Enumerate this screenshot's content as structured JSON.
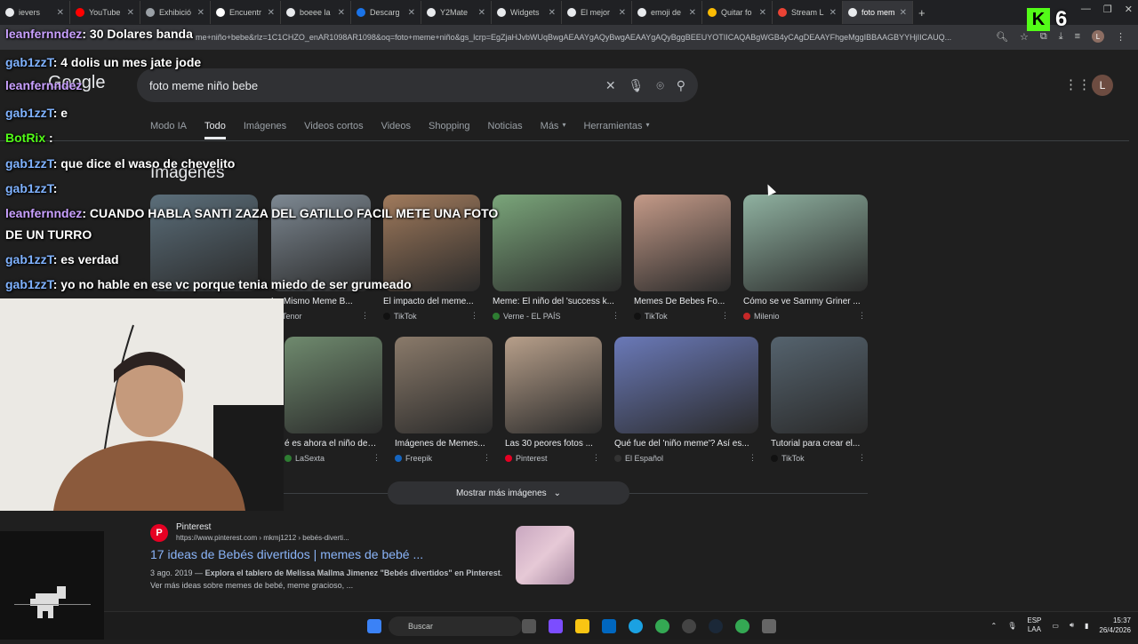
{
  "browser": {
    "tabs": [
      {
        "label": "ievers",
        "color": "#e8eaed"
      },
      {
        "label": "YouTube",
        "color": "#ff0000"
      },
      {
        "label": "Exhibició",
        "color": "#9aa0a6"
      },
      {
        "label": "Encuentr",
        "color": "#ffffff"
      },
      {
        "label": "boeee la",
        "color": "#e8eaed"
      },
      {
        "label": "Descarg",
        "color": "#1a73e8"
      },
      {
        "label": "Y2Mate",
        "color": "#e8eaed"
      },
      {
        "label": "Widgets",
        "color": "#e8eaed"
      },
      {
        "label": "El mejor",
        "color": "#e8eaed"
      },
      {
        "label": "emoji de",
        "color": "#e8eaed"
      },
      {
        "label": "Quitar fo",
        "color": "#fbbc04"
      },
      {
        "label": "Stream L",
        "color": "#ea4335"
      },
      {
        "label": "foto mem",
        "color": "#e8eaed",
        "active": true
      }
    ],
    "url": "me+niño+bebe&rlz=1C1CHZO_enAR1098AR1098&oq=foto+meme+niño&gs_lcrp=EgZjaHJvbWUqBwgAEAAYgAQyBwgAEAAYgAQyBggBEEUYOTIICAQABgWGB4yCAgDEAAYFhgeMggIBBAAGBYYHjIICAUQ...",
    "profile_initial": "L"
  },
  "google": {
    "logo": "Google",
    "query": "foto meme niño bebe",
    "avatar_initial": "L",
    "nav": [
      "Modo IA",
      "Todo",
      "Imágenes",
      "Videos cortos",
      "Videos",
      "Shopping",
      "Noticias",
      "Más",
      "Herramientas"
    ],
    "images_heading": "Imágenes",
    "images_row1": [
      {
        "caption": "",
        "source": ""
      },
      {
        "caption": "Lo Mismo Meme B...",
        "source": "Tenor"
      },
      {
        "caption": "El impacto del meme...",
        "source": "TikTok"
      },
      {
        "caption": "Meme: El niño del 'success k...",
        "source": "Verne - EL PAÍS"
      },
      {
        "caption": "Memes De Bebes Fo...",
        "source": "TikTok"
      },
      {
        "caption": "Cómo se ve Sammy Griner ...",
        "source": "Milenio"
      }
    ],
    "images_row2": [
      {
        "caption": "é es ahora el niño del ...",
        "source": "LaSexta"
      },
      {
        "caption": "Imágenes de Memes...",
        "source": "Freepik"
      },
      {
        "caption": "Las 30 peores fotos ...",
        "source": "Pinterest"
      },
      {
        "caption": "Qué fue del 'niño meme'? Así es...",
        "source": "El Español"
      },
      {
        "caption": "Tutorial para crear el...",
        "source": "TikTok"
      }
    ],
    "more_images": "Mostrar más imágenes",
    "result": {
      "site": "Pinterest",
      "cite": "https://www.pinterest.com › mkmj1212 › bebés-diverti...",
      "title": "17 ideas de Bebés divertidos | memes de bebé ...",
      "date": "3 ago. 2019",
      "snippet_bold": "Explora el tablero de Melissa Mallma Jimenez \"Bebés divertidos\" en Pinterest",
      "snippet_rest": ". Ver más ideas sobre memes de bebé, meme gracioso, ..."
    }
  },
  "stream": {
    "chat": [
      {
        "user": "leanfernndez",
        "text": ": 30 Dolares banda",
        "color": "#c9a0ff"
      },
      {
        "user": "gab1zzT",
        "text": ": 4 dolis un mes jate jode",
        "color": "#7fb2ff"
      },
      {
        "user": "leanfernndez",
        "text": "",
        "color": "#c9a0ff"
      },
      {
        "user": "gab1zzT",
        "text": ": e",
        "color": "#7fb2ff"
      },
      {
        "user": "BotRix",
        "text": " :",
        "color": "#53fc18"
      },
      {
        "user": "gab1zzT",
        "text": ": que dice el waso de chevelito",
        "color": "#7fb2ff"
      },
      {
        "user": "gab1zzT",
        "text": ":",
        "color": "#7fb2ff"
      },
      {
        "user": "leanfernndez",
        "text": ": CUANDO HABLA SANTI ZAZA DEL GATILLO FACIL METE UNA FOTO",
        "color": "#c9a0ff"
      },
      {
        "user": "",
        "text": "DE UN TURRO",
        "color": "#ffffff"
      },
      {
        "user": "gab1zzT",
        "text": ": es verdad",
        "color": "#7fb2ff"
      },
      {
        "user": "gab1zzT",
        "text": ": yo no hable en ese vc porque tenia miedo de ser grumeado",
        "color": "#7fb2ff"
      }
    ],
    "kick_count": "6"
  },
  "taskbar": {
    "search_placeholder": "Buscar",
    "lang": "ESP",
    "lang2": "LAA",
    "time": "15:37",
    "date": "26/4/2026"
  }
}
